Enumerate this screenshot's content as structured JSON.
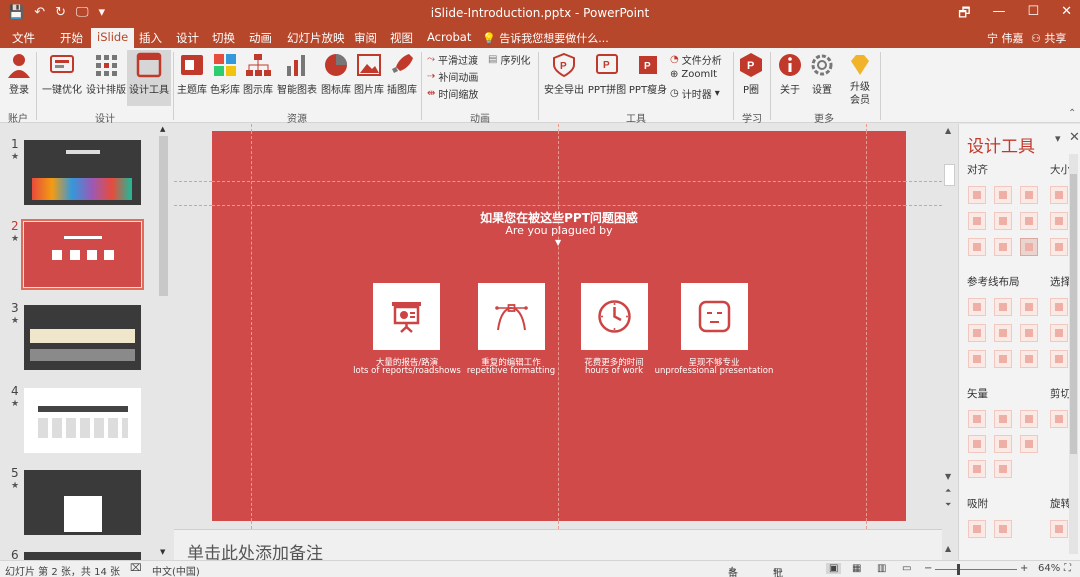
{
  "window": {
    "title": "iSlide-Introduction.pptx - PowerPoint",
    "qat": [
      "💾",
      "↶",
      "↻",
      "🖵",
      "▾"
    ],
    "controls": [
      "🗗",
      "—",
      "☐",
      "✕"
    ]
  },
  "menu": {
    "tabs": [
      "文件",
      "开始",
      "iSlide",
      "插入",
      "设计",
      "切换",
      "动画",
      "幻灯片放映",
      "审阅",
      "视图",
      "Acrobat"
    ],
    "active": "iSlide",
    "tell_me": "告诉我您想要做什么...",
    "user": "宁 伟嘉",
    "share": "共享"
  },
  "ribbon": {
    "account": {
      "login": "登录",
      "group": "账户"
    },
    "design": {
      "items": [
        "一键优化",
        "设计排版",
        "设计工具"
      ],
      "group": "设计"
    },
    "resources": {
      "items": [
        "主题库",
        "色彩库",
        "图示库",
        "智能图表",
        "图标库",
        "图片库",
        "插图库"
      ],
      "group": "资源"
    },
    "animation": {
      "items": [
        "平滑过渡",
        "补间动画",
        "时间缩放",
        "序列化"
      ],
      "group": "动画"
    },
    "tools": {
      "items": [
        "安全导出",
        "PPT拼图",
        "PPT瘦身",
        "文件分析",
        "ZoomIt",
        "计时器"
      ],
      "group": "工具"
    },
    "learn": {
      "items": [
        "P圈"
      ],
      "group": "学习"
    },
    "more": {
      "items": [
        "关于",
        "设置",
        "升级会员"
      ],
      "group": "更多"
    }
  },
  "thumbnails": [
    {
      "num": "1",
      "star": "★"
    },
    {
      "num": "2",
      "star": "★"
    },
    {
      "num": "3",
      "star": "★"
    },
    {
      "num": "4",
      "star": "★"
    },
    {
      "num": "5",
      "star": "★"
    },
    {
      "num": "6",
      "star": ""
    }
  ],
  "slide": {
    "title": "如果您在被这些PPT问题困惑",
    "subtitle": "Are you plagued by",
    "arrow": "▼",
    "cards": [
      {
        "icon": "presentation-board-icon",
        "cn": "大量的报告/路演",
        "en": "lots of reports/roadshows"
      },
      {
        "icon": "bezier-pen-icon",
        "cn": "重复的编辑工作",
        "en": "repetitive formatting"
      },
      {
        "icon": "clock-icon",
        "cn": "花费更多的时间",
        "en": "hours of work"
      },
      {
        "icon": "face-icon",
        "cn": "呈现不够专业",
        "en": "unprofessional presentation"
      }
    ]
  },
  "notes_placeholder": "单击此处添加备注",
  "pane": {
    "title": "设计工具",
    "sections": [
      "对齐",
      "大小",
      "参考线布局",
      "选择",
      "矢量",
      "剪切",
      "吸附",
      "旋转"
    ]
  },
  "status": {
    "slide_info": "幻灯片 第 2 张，共 14 张",
    "language": "中文(中国)",
    "notes": "备注",
    "comments": "批注",
    "zoom_minus": "−",
    "zoom_plus": "+",
    "zoom": "64%"
  },
  "colors": {
    "accent": "#b7472a",
    "slide_red": "#d04a4a"
  }
}
